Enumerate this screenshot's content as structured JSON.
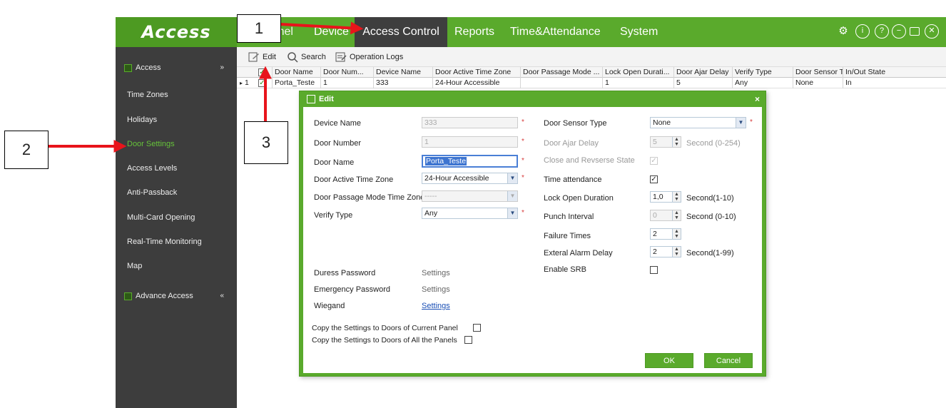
{
  "app": {
    "logo": "Access",
    "menu": [
      "Panel",
      "Device",
      "Access Control",
      "Reports",
      "Time&Attendance",
      "System"
    ],
    "active_menu": "Access Control"
  },
  "sidebar": {
    "group1": "Access",
    "items": [
      "Time Zones",
      "Holidays",
      "Door Settings",
      "Access Levels",
      "Anti-Passback",
      "Multi-Card Opening",
      "Real-Time Monitoring",
      "Map"
    ],
    "active_item": "Door Settings",
    "group2": "Advance Access"
  },
  "toolbar": {
    "edit": "Edit",
    "search": "Search",
    "operation_logs": "Operation Logs"
  },
  "grid": {
    "columns": [
      "Door Name",
      "Door Num...",
      "Device Name",
      "Door Active Time Zone",
      "Door Passage Mode ...",
      "Lock Open Durati...",
      "Door Ajar Delay",
      "Verify Type",
      "Door Sensor T...",
      "In/Out State"
    ],
    "row": {
      "index": "1",
      "cells": [
        "Porta_Teste",
        "1",
        "333",
        "24-Hour Accessible",
        "",
        "1",
        "5",
        "Any",
        "None",
        "In"
      ]
    }
  },
  "dialog": {
    "title": "Edit",
    "left": {
      "device_name_label": "Device Name",
      "device_name_value": "333",
      "door_number_label": "Door Number",
      "door_number_value": "1",
      "door_name_label": "Door Name",
      "door_name_value": "Porta_Teste",
      "active_tz_label": "Door Active Time Zone",
      "active_tz_value": "24-Hour Accessible",
      "passage_tz_label": "Door Passage Mode Time Zone",
      "passage_tz_value": "-----",
      "verify_label": "Verify Type",
      "verify_value": "Any",
      "duress_label": "Duress Password",
      "duress_value": "Settings",
      "emergency_label": "Emergency Password",
      "emergency_value": "Settings",
      "wiegand_label": "Wiegand",
      "wiegand_value": "Settings",
      "copy_current": "Copy the Settings to Doors of Current Panel",
      "copy_all": "Copy the Settings to Doors of All the Panels"
    },
    "right": {
      "sensor_label": "Door Sensor Type",
      "sensor_value": "None",
      "ajar_label": "Door Ajar Delay",
      "ajar_value": "5",
      "ajar_unit": "Second (0-254)",
      "close_label": "Close and Revserse State",
      "ta_label": "Time attendance",
      "lock_label": "Lock Open Duration",
      "lock_value": "1,0",
      "lock_unit": "Second(1-10)",
      "punch_label": "Punch Interval",
      "punch_value": "0",
      "punch_unit": "Second (0-10)",
      "failure_label": "Failure Times",
      "failure_value": "2",
      "alarm_label": "Exteral Alarm Delay",
      "alarm_value": "2",
      "alarm_unit": "Second(1-99)",
      "srb_label": "Enable SRB"
    },
    "ok": "OK",
    "cancel": "Cancel"
  },
  "annotations": [
    "1",
    "2",
    "3"
  ],
  "colors": {
    "brand_green": "#5aaa2c",
    "dark": "#3d3d3d",
    "arrow_red": "#e8141b"
  }
}
